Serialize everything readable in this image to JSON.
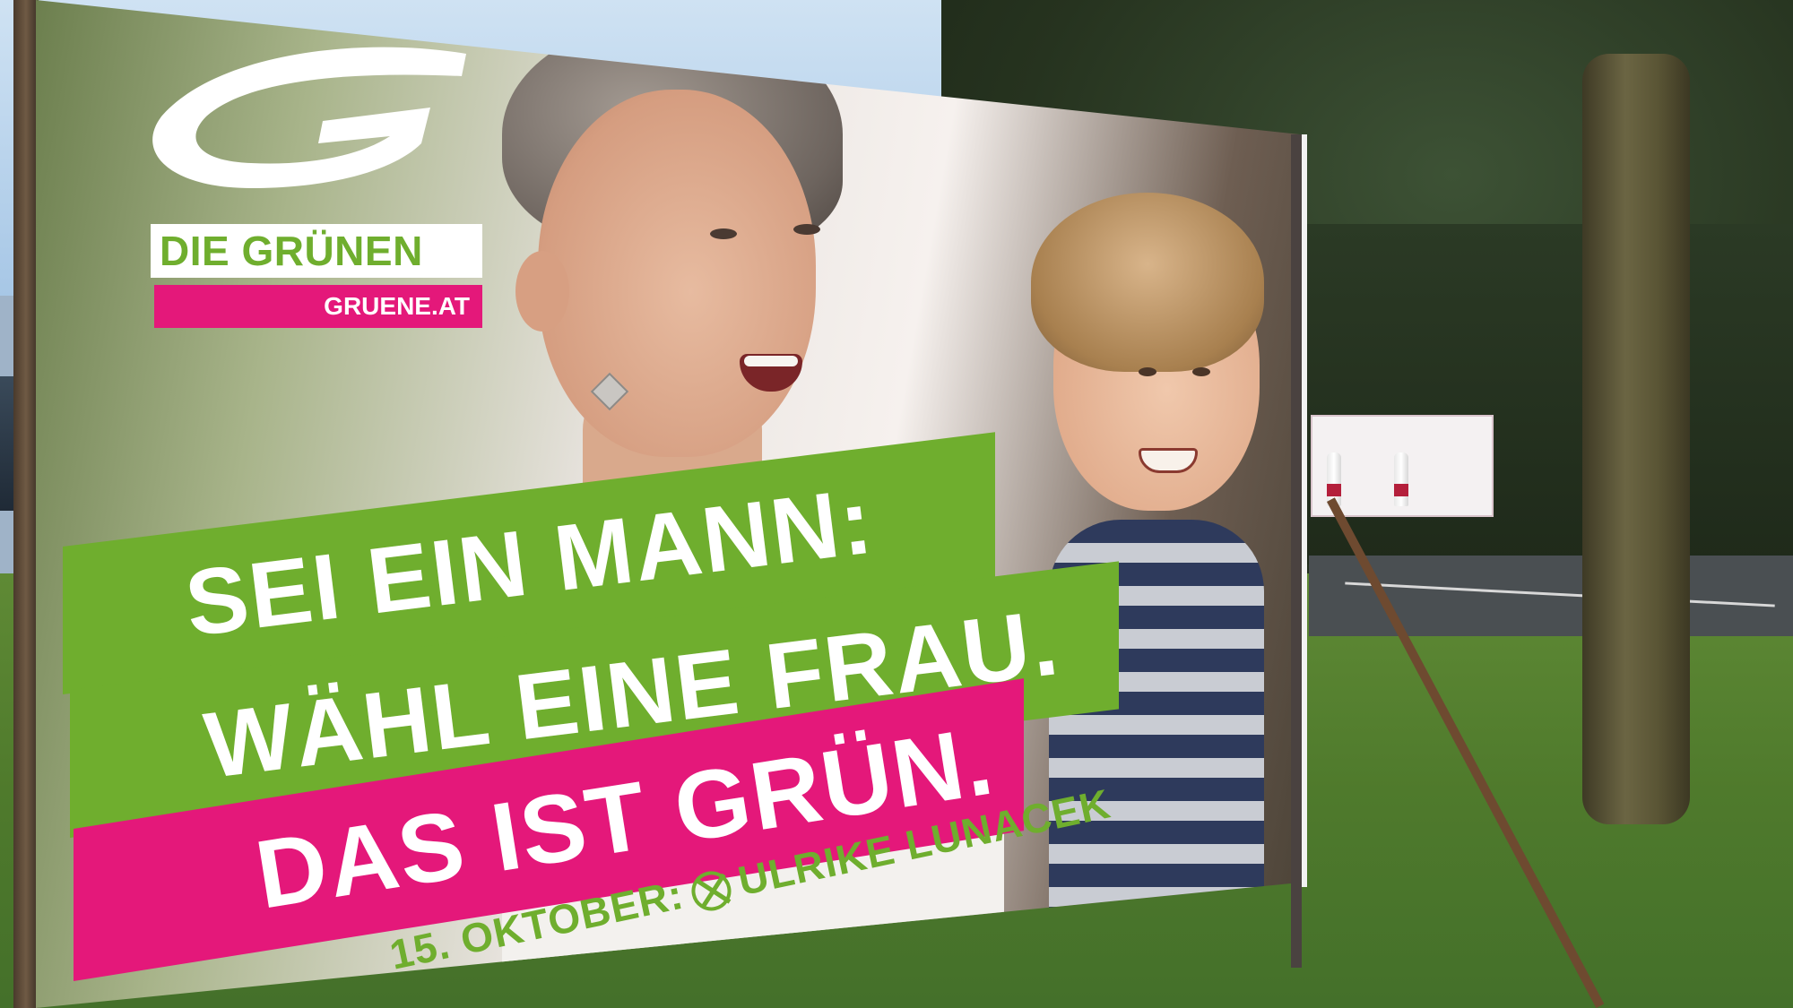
{
  "logo": {
    "brand_name": "DIE GRÜNEN",
    "url": "GRUENE.AT",
    "icon": "stylized-g-brushstroke-logo"
  },
  "slogan": {
    "line1": "SEI EIN MANN:",
    "line2": "WÄHL EINE FRAU.",
    "line3": "DAS IST GRÜN."
  },
  "election": {
    "date_text": "15. OKTOBER:",
    "candidate": "ULRIKE LUNACEK",
    "ballot_icon": "ballot-cross-mark-icon"
  },
  "colors": {
    "brand_green": "#6fae2e",
    "brand_pink": "#e4187a",
    "text_white": "#ffffff"
  }
}
